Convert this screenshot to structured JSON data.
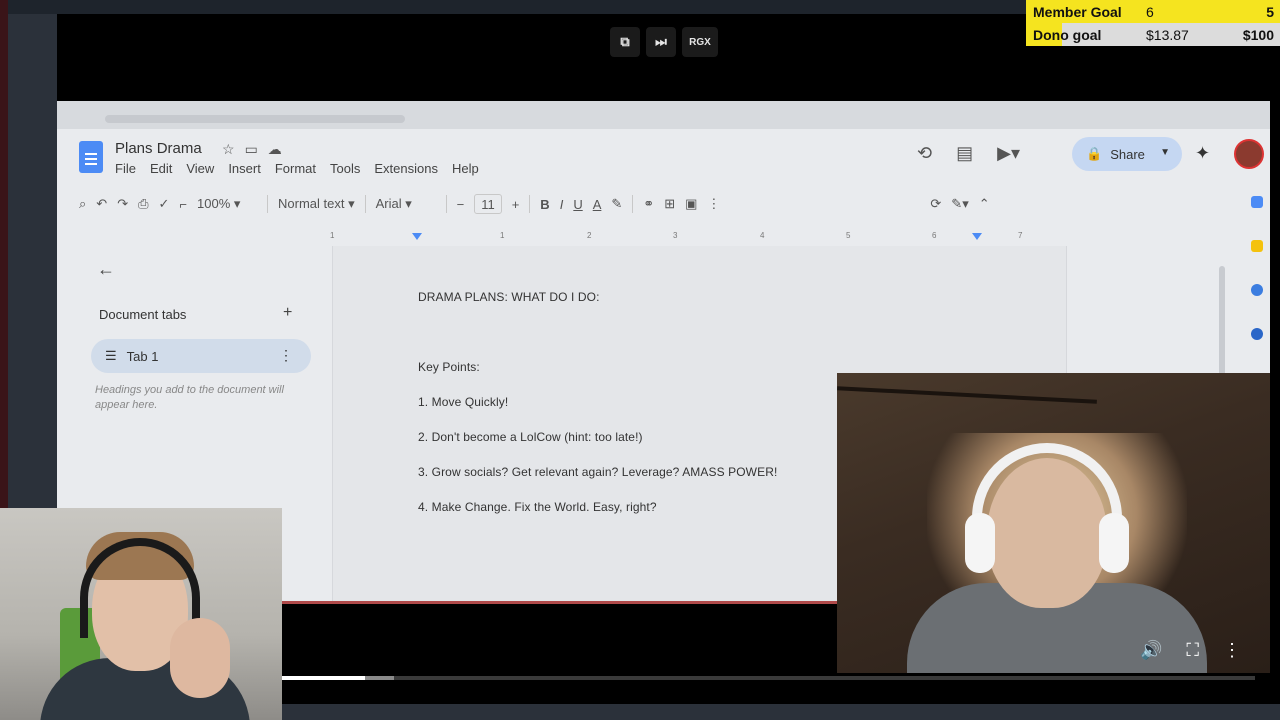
{
  "player": {
    "controls": [
      {
        "icon": "popout-icon",
        "glyph": "⧉"
      },
      {
        "icon": "skip-next-icon",
        "glyph": "⏭"
      },
      {
        "icon": "rgx-icon",
        "label": "RGX"
      }
    ],
    "progress": 0.085,
    "buffered": 0.115,
    "bottom_controls": [
      "volume-icon",
      "fullscreen-icon",
      "more-vert-icon"
    ],
    "bottom_glyphs": {
      "volume": "🔊",
      "fullscreen": "⛶",
      "more": "⋮"
    }
  },
  "goals": {
    "member": {
      "label": "Member Goal",
      "current": "6",
      "target": "5",
      "fill": 1.0
    },
    "dono": {
      "label": "Dono goal",
      "current": "$13.87",
      "target": "$100",
      "fill": 0.14
    },
    "colors": {
      "fill": "#f5e41f",
      "track": "#dcdcdc"
    }
  },
  "docs": {
    "title": "Plans Drama",
    "menu": [
      "File",
      "Edit",
      "View",
      "Insert",
      "Format",
      "Tools",
      "Extensions",
      "Help"
    ],
    "share_label": "Share",
    "toolbar": {
      "zoom": "100%",
      "style": "Normal text",
      "font": "Arial",
      "font_size": "11"
    },
    "ruler_ticks": [
      "1",
      "1",
      "2",
      "3",
      "4",
      "5",
      "6",
      "7"
    ],
    "side_panel": {
      "heading": "Document tabs",
      "tab_label": "Tab 1",
      "hint": "Headings you add to the document will appear here."
    },
    "content": {
      "heading": "DRAMA PLANS:  WHAT DO I DO:",
      "key_points": "Key Points:",
      "items": [
        "1. Move Quickly!",
        "2.  Don't become a LolCow (hint: too late!)",
        "3. Grow socials?  Get relevant again?  Leverage? AMASS POWER!",
        "4. Make Change.  Fix the World. Easy, right?"
      ]
    }
  }
}
